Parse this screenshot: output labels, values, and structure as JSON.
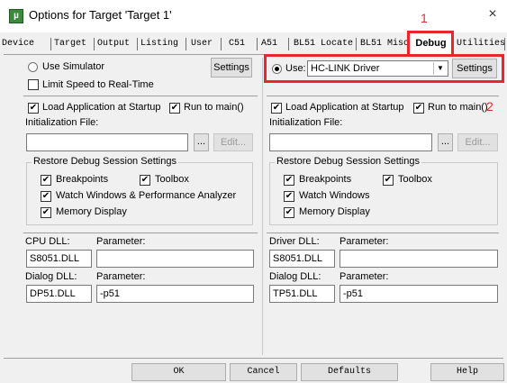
{
  "window": {
    "title": "Options for Target 'Target 1'",
    "icon_label": "µ",
    "close_icon": "×"
  },
  "tabs": [
    {
      "label": "Device"
    },
    {
      "label": "Target"
    },
    {
      "label": "Output"
    },
    {
      "label": "Listing"
    },
    {
      "label": "User"
    },
    {
      "label": "C51"
    },
    {
      "label": "A51"
    },
    {
      "label": "BL51 Locate"
    },
    {
      "label": "BL51 Misc"
    },
    {
      "label": "Debug",
      "active": true
    },
    {
      "label": "Utilities"
    }
  ],
  "annotations": {
    "one": "1",
    "two": "2"
  },
  "left": {
    "use_simulator_label": "Use Simulator",
    "settings_label": "Settings",
    "limit_speed_label": "Limit Speed to Real-Time",
    "load_app_label": "Load Application at Startup",
    "run_to_main_label": "Run to main()",
    "init_file_label": "Initialization File:",
    "init_file_value": "",
    "browse_label": "...",
    "edit_label": "Edit...",
    "restore_title": "Restore Debug Session Settings",
    "breakpoints_label": "Breakpoints",
    "toolbox_label": "Toolbox",
    "watch_label": "Watch Windows & Performance Analyzer",
    "memory_label": "Memory Display",
    "cpu_dll_label": "CPU DLL:",
    "cpu_param_label": "Parameter:",
    "cpu_dll_value": "S8051.DLL",
    "cpu_param_value": "",
    "dialog_dll_label": "Dialog DLL:",
    "dialog_param_label": "Parameter:",
    "dialog_dll_value": "DP51.DLL",
    "dialog_param_value": "-p51"
  },
  "right": {
    "use_label": "Use:",
    "driver_value": "HC-LINK Driver",
    "settings_label": "Settings",
    "load_app_label": "Load Application at Startup",
    "run_to_main_label": "Run to main()",
    "init_file_label": "Initialization File:",
    "init_file_value": "",
    "browse_label": "...",
    "edit_label": "Edit...",
    "restore_title": "Restore Debug Session Settings",
    "breakpoints_label": "Breakpoints",
    "toolbox_label": "Toolbox",
    "watch_label": "Watch Windows",
    "memory_label": "Memory Display",
    "driver_dll_label": "Driver DLL:",
    "driver_param_label": "Parameter:",
    "driver_dll_value": "S8051.DLL",
    "driver_param_value": "",
    "dialog_dll_label": "Dialog DLL:",
    "dialog_param_label": "Parameter:",
    "dialog_dll_value": "TP51.DLL",
    "dialog_param_value": "-p51"
  },
  "footer": {
    "ok_label": "OK",
    "cancel_label": "Cancel",
    "defaults_label": "Defaults",
    "help_label": "Help"
  },
  "check_mark": "✔",
  "combo_arrow": "▼",
  "colors": {
    "annotation_red": "#e8262b",
    "panel_bg": "#f0f0f0"
  }
}
